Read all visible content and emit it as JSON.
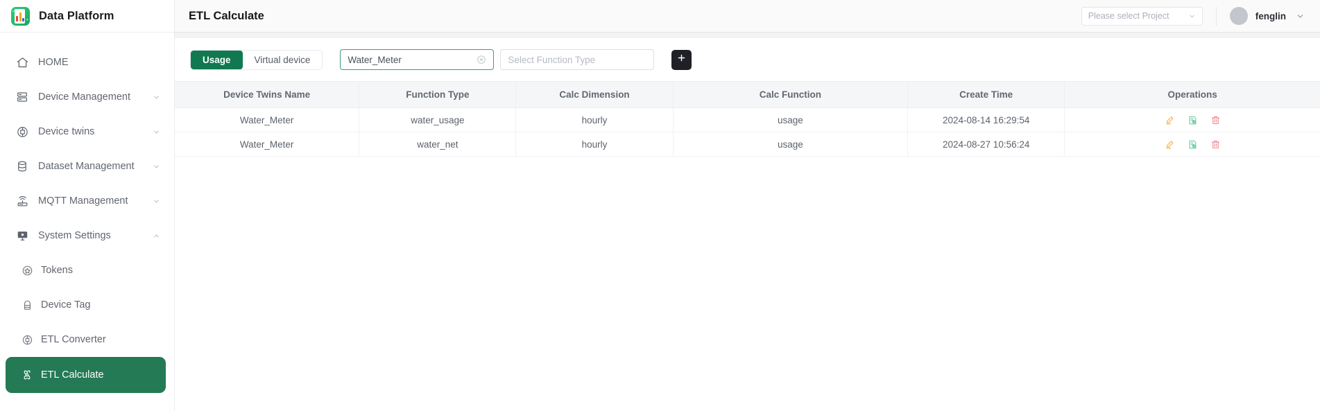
{
  "brand": {
    "title": "Data Platform",
    "logo_icon": "bar-chart-logo-icon",
    "accent_color": "#21b866"
  },
  "sidebar": {
    "items": [
      {
        "label": "HOME",
        "icon": "home-icon",
        "has_chevron": false,
        "name": "home"
      },
      {
        "label": "Device Management",
        "icon": "server-icon",
        "has_chevron": true,
        "chevron": "chevron-down-icon",
        "name": "device-management"
      },
      {
        "label": "Device twins",
        "icon": "device-twins-icon",
        "has_chevron": true,
        "chevron": "chevron-down-icon",
        "name": "device-twins"
      },
      {
        "label": "Dataset Management",
        "icon": "database-icon",
        "has_chevron": true,
        "chevron": "chevron-down-icon",
        "name": "dataset-management"
      },
      {
        "label": "MQTT Management",
        "icon": "router-wifi-icon",
        "has_chevron": true,
        "chevron": "chevron-down-icon",
        "name": "mqtt-management"
      },
      {
        "label": "System Settings",
        "icon": "monitor-settings-icon",
        "has_chevron": true,
        "chevron": "chevron-up-icon",
        "name": "system-settings"
      }
    ],
    "sub_items": [
      {
        "label": "Tokens",
        "icon": "star-badge-icon",
        "active": false,
        "name": "tokens"
      },
      {
        "label": "Device Tag",
        "icon": "tag-icon",
        "active": false,
        "name": "device-tag"
      },
      {
        "label": "ETL Converter",
        "icon": "converter-icon",
        "active": false,
        "name": "etl-converter"
      },
      {
        "label": "ETL Calculate",
        "icon": "calculate-icon",
        "active": true,
        "name": "etl-calculate"
      }
    ],
    "active_color": "#237a54"
  },
  "topbar": {
    "page_title": "ETL Calculate",
    "project_select": {
      "placeholder": "Please select Project",
      "value": "",
      "chevron": "chevron-down-icon"
    },
    "user": {
      "name": "fenglin",
      "avatar": "avatar",
      "chevron": "chevron-down-icon"
    }
  },
  "toolbar": {
    "segments": [
      {
        "label": "Usage",
        "active": true,
        "name": "usage"
      },
      {
        "label": "Virtual device",
        "active": false,
        "name": "virtual-device"
      }
    ],
    "device_twins_input": {
      "value": "Water_Meter",
      "placeholder": "",
      "clear_icon": "clear-circle-icon"
    },
    "function_type_input": {
      "value": "",
      "placeholder": "Select Function Type"
    },
    "add_button": {
      "label": "+",
      "icon": "plus-icon"
    }
  },
  "table": {
    "columns": [
      "Device Twins Name",
      "Function Type",
      "Calc Dimension",
      "Calc Function",
      "Create Time",
      "Operations"
    ],
    "rows": [
      {
        "device_twins_name": "Water_Meter",
        "function_type": "water_usage",
        "calc_dimension": "hourly",
        "calc_function": "usage",
        "create_time": "2024-08-14 16:29:54"
      },
      {
        "device_twins_name": "Water_Meter",
        "function_type": "water_net",
        "calc_dimension": "hourly",
        "calc_function": "usage",
        "create_time": "2024-08-27 10:56:24"
      }
    ],
    "operations": [
      {
        "name": "edit",
        "icon": "pencil-edit-icon",
        "color": "#f0ad4e"
      },
      {
        "name": "view",
        "icon": "document-preview-icon",
        "color": "#5fc59a"
      },
      {
        "name": "delete",
        "icon": "trash-icon",
        "color": "#f2838d"
      }
    ]
  }
}
